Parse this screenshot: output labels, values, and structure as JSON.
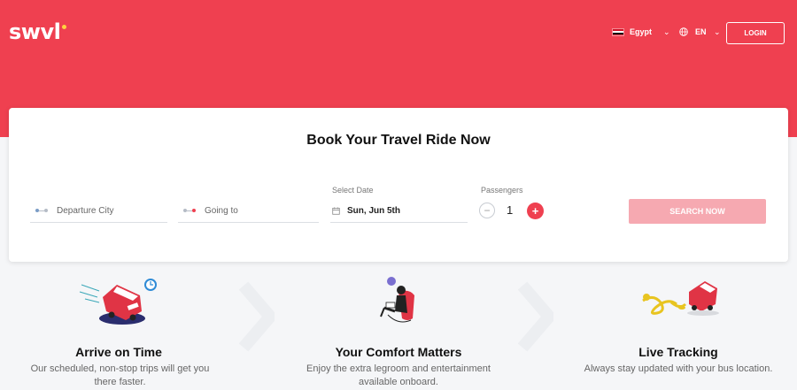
{
  "brand": {
    "logo_text": "swvl",
    "primary_color": "#ef4050",
    "accent_color": "#ffd23f"
  },
  "header": {
    "country": "Egypt",
    "country_flag": "egypt-flag-icon",
    "language": "EN",
    "login_label": "LOGIN"
  },
  "booking": {
    "title": "Book Your Travel Ride Now",
    "departure_placeholder": "Departure City",
    "destination_placeholder": "Going to",
    "date_label": "Select Date",
    "date_value": "Sun, Jun 5th",
    "passengers_label": "Passengers",
    "passengers_value": "1",
    "search_label": "SEARCH NOW"
  },
  "features": [
    {
      "title": "Arrive on Time",
      "desc_line1": "Our scheduled, non-stop trips will get you",
      "desc_line2": "there faster.",
      "icon": "bus-clock-icon"
    },
    {
      "title": "Your Comfort Matters",
      "desc_line1": "Enjoy the extra legroom and entertainment",
      "desc_line2": "available onboard.",
      "icon": "comfort-seat-icon"
    },
    {
      "title": "Live Tracking",
      "desc_line1": "Always stay updated with your bus location.",
      "desc_line2": "",
      "icon": "bus-tracking-icon"
    }
  ]
}
